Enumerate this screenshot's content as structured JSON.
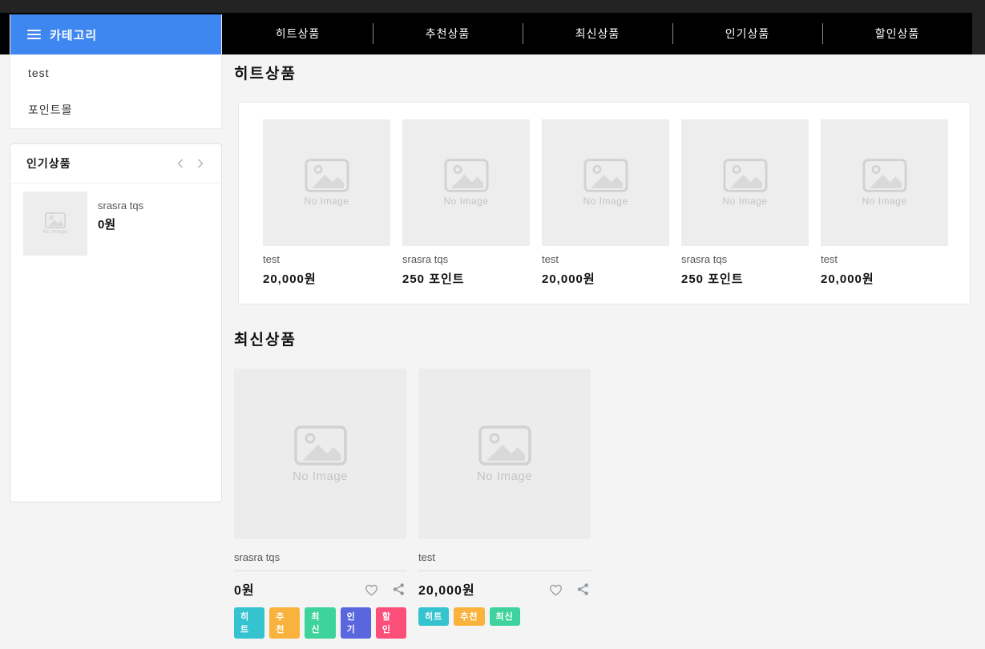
{
  "nav": {
    "items": [
      {
        "label": "히트상품"
      },
      {
        "label": "추천상품"
      },
      {
        "label": "최신상품"
      },
      {
        "label": "인기상품"
      },
      {
        "label": "할인상품"
      }
    ]
  },
  "sidebar": {
    "category": {
      "title": "카테고리",
      "items": [
        {
          "label": "test"
        },
        {
          "label": "포인트몰"
        }
      ]
    },
    "popular": {
      "title": "인기상품",
      "products": [
        {
          "name": "srasra tqs",
          "price": "0원"
        }
      ]
    }
  },
  "placeholder": {
    "label": "No Image"
  },
  "sections": {
    "hit": {
      "title": "히트상품",
      "products": [
        {
          "name": "test",
          "price": "20,000원"
        },
        {
          "name": "srasra tqs",
          "price": "250 포인트"
        },
        {
          "name": "test",
          "price": "20,000원"
        },
        {
          "name": "srasra tqs",
          "price": "250 포인트"
        },
        {
          "name": "test",
          "price": "20,000원"
        }
      ]
    },
    "latest": {
      "title": "최신상품",
      "products": [
        {
          "name": "srasra tqs",
          "price": "0원",
          "badges": [
            "히트",
            "추천",
            "최신",
            "인기",
            "할인"
          ]
        },
        {
          "name": "test",
          "price": "20,000원",
          "badges": [
            "히트",
            "추천",
            "최신"
          ]
        }
      ]
    }
  },
  "icons": {
    "hamburger": "menu",
    "chevron_left": "carousel-prev",
    "chevron_right": "carousel-next",
    "heart": "wishlist",
    "share": "share",
    "no_image": "image-placeholder"
  },
  "colors": {
    "accent": "#3e86f0",
    "nav_bg": "#000000",
    "header_bg": "#232323",
    "badge_hit": "#35c3cf",
    "badge_rec": "#f9b33c",
    "badge_new": "#3ed39e",
    "badge_pop": "#5a66de",
    "badge_dis": "#fb4e79"
  }
}
